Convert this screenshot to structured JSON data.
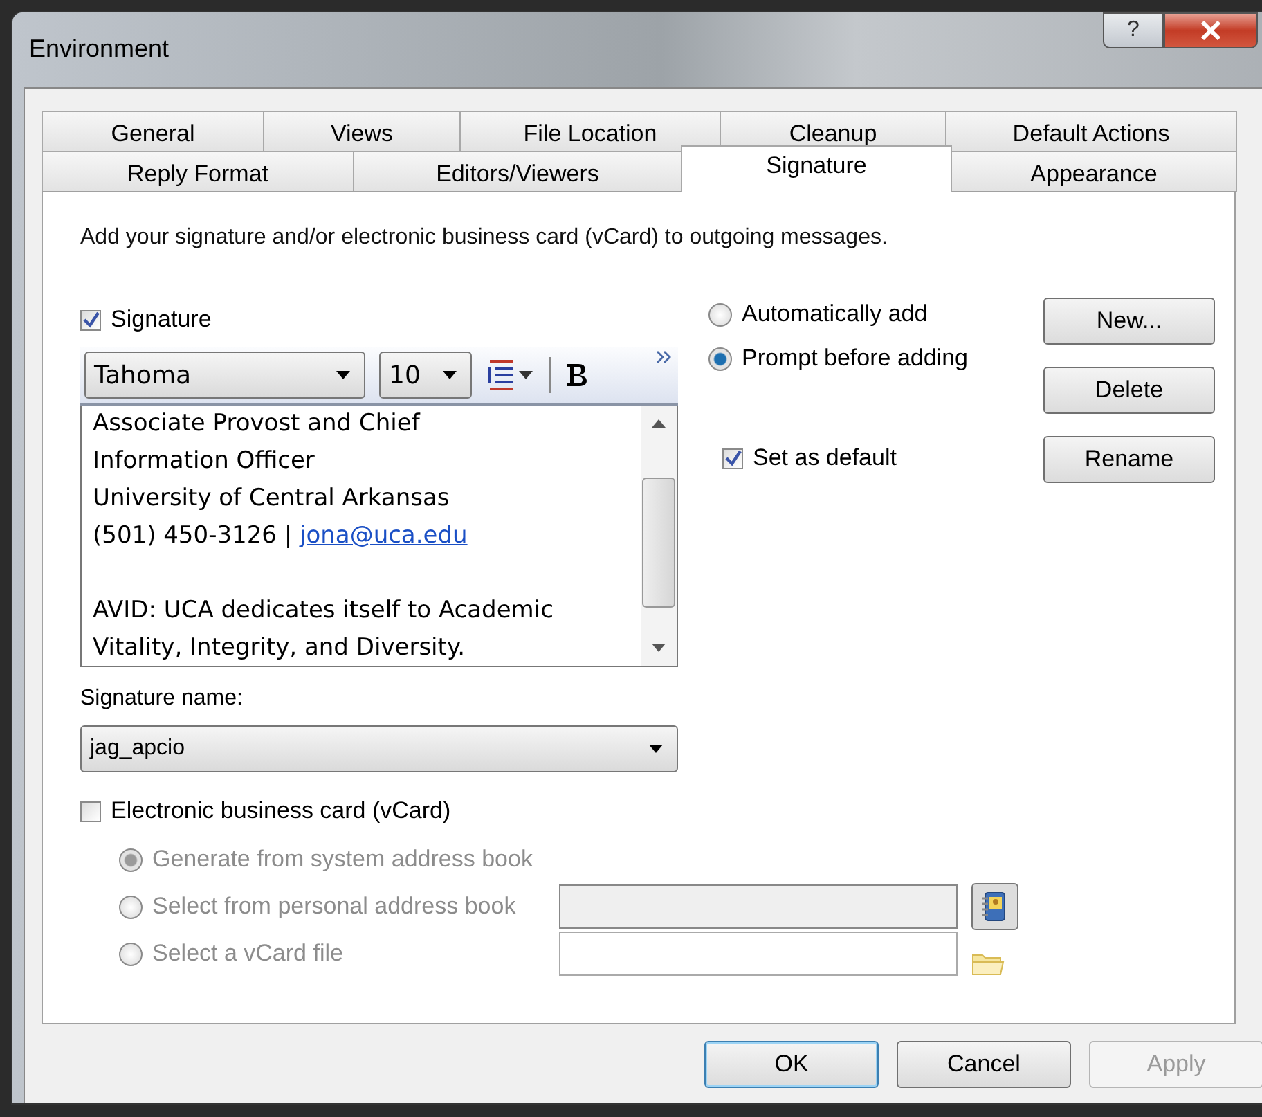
{
  "window": {
    "title": "Environment",
    "help": "?"
  },
  "tab_rows": [
    [
      {
        "label": "General",
        "selected": false
      },
      {
        "label": "Views",
        "selected": false
      },
      {
        "label": "File Location",
        "selected": false
      },
      {
        "label": "Cleanup",
        "selected": false
      },
      {
        "label": "Default Actions",
        "selected": false
      }
    ],
    [
      {
        "label": "Reply Format",
        "selected": false
      },
      {
        "label": "Editors/Viewers",
        "selected": false
      },
      {
        "label": "Signature",
        "selected": true
      },
      {
        "label": "Appearance",
        "selected": false
      }
    ]
  ],
  "description": "Add your signature and/or electronic business card (vCard) to outgoing messages.",
  "signature": {
    "label": "Signature",
    "checked": true
  },
  "editor": {
    "font": "Tahoma",
    "size": "10",
    "lines": [
      {
        "kind": "text",
        "text": "Associate Provost and Chief"
      },
      {
        "kind": "text",
        "text": "Information Officer"
      },
      {
        "kind": "text",
        "text": "University of Central Arkansas"
      },
      {
        "kind": "text",
        "text": "(501) 450-3126 | ",
        "link": "jona@uca.edu"
      },
      {
        "kind": "blank"
      },
      {
        "kind": "text",
        "text": "AVID: UCA dedicates itself to Academic"
      },
      {
        "kind": "text",
        "text": "Vitality, Integrity, and Diversity."
      }
    ]
  },
  "insert_options": [
    {
      "label": "Automatically add",
      "selected": false
    },
    {
      "label": "Prompt before adding",
      "selected": true
    }
  ],
  "set_default": {
    "label": "Set as default",
    "checked": true
  },
  "signature_buttons": [
    "New...",
    "Delete",
    "Rename"
  ],
  "signature_name": {
    "label": "Signature name:",
    "value": "jag_apcio"
  },
  "vcard": {
    "label": "Electronic business card (vCard)",
    "checked": false
  },
  "vcard_options": [
    {
      "label": "Generate from system address book",
      "selected": true,
      "disabled": true,
      "kind": "plain"
    },
    {
      "label": "Select from personal address book",
      "selected": false,
      "disabled": true,
      "kind": "addressbook"
    },
    {
      "label": "Select a vCard file",
      "selected": false,
      "disabled": true,
      "kind": "file"
    }
  ],
  "dialog_buttons": [
    {
      "label": "OK",
      "disabled": false,
      "default": true
    },
    {
      "label": "Cancel",
      "disabled": false,
      "default": false
    },
    {
      "label": "Apply",
      "disabled": true,
      "default": false
    }
  ]
}
